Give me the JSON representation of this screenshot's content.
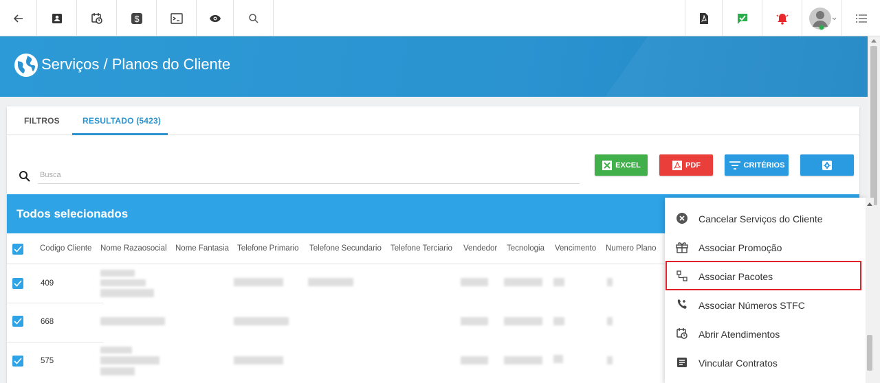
{
  "toolbar": {
    "left_icons": [
      "back-arrow-icon",
      "contact-card-icon",
      "calendar-clock-icon",
      "dollar-icon",
      "terminal-icon",
      "eye-icon",
      "search-icon"
    ],
    "right_icons": [
      "pdf-icon",
      "chat-check-icon",
      "alarm-bell-icon",
      "user-avatar-icon",
      "list-menu-icon"
    ]
  },
  "header": {
    "title": "Serviços / Planos do Cliente"
  },
  "tabs": [
    {
      "label": "FILTROS",
      "active": false
    },
    {
      "label": "RESULTADO (5423)",
      "active": true
    }
  ],
  "search": {
    "placeholder": "Busca",
    "value": ""
  },
  "actions": {
    "excel": "EXCEL",
    "pdf": "PDF",
    "criterios": "CRITÉRIOS"
  },
  "selection": {
    "title": "Todos selecionados"
  },
  "table": {
    "columns": [
      "Codigo Cliente",
      "Nome Razaosocial",
      "Nome Fantasia",
      "Telefone Primario",
      "Telefone Secundario",
      "Telefone Terciario",
      "Vendedor",
      "Tecnologia",
      "Vencimento",
      "Numero Plano"
    ],
    "rows": [
      {
        "codigo": "409",
        "checked": true
      },
      {
        "codigo": "668",
        "checked": true
      },
      {
        "codigo": "575",
        "checked": true
      }
    ]
  },
  "context_menu": {
    "items": [
      {
        "label": "Cancelar Serviços do Cliente",
        "icon": "cancel-circle-icon"
      },
      {
        "label": "Associar Promoção",
        "icon": "gift-icon"
      },
      {
        "label": "Associar Pacotes",
        "icon": "package-link-icon",
        "highlighted": true
      },
      {
        "label": "Associar Números STFC",
        "icon": "phone-forward-icon"
      },
      {
        "label": "Abrir Atendimentos",
        "icon": "calendar-clock-icon"
      },
      {
        "label": "Vincular Contratos",
        "icon": "document-icon"
      }
    ]
  },
  "colors": {
    "primary_blue": "#2a93d0",
    "selection_bar": "#2ea3e6",
    "excel_green": "#41b04b",
    "pdf_red": "#ea3e3a",
    "highlight_red": "#e0202a"
  }
}
